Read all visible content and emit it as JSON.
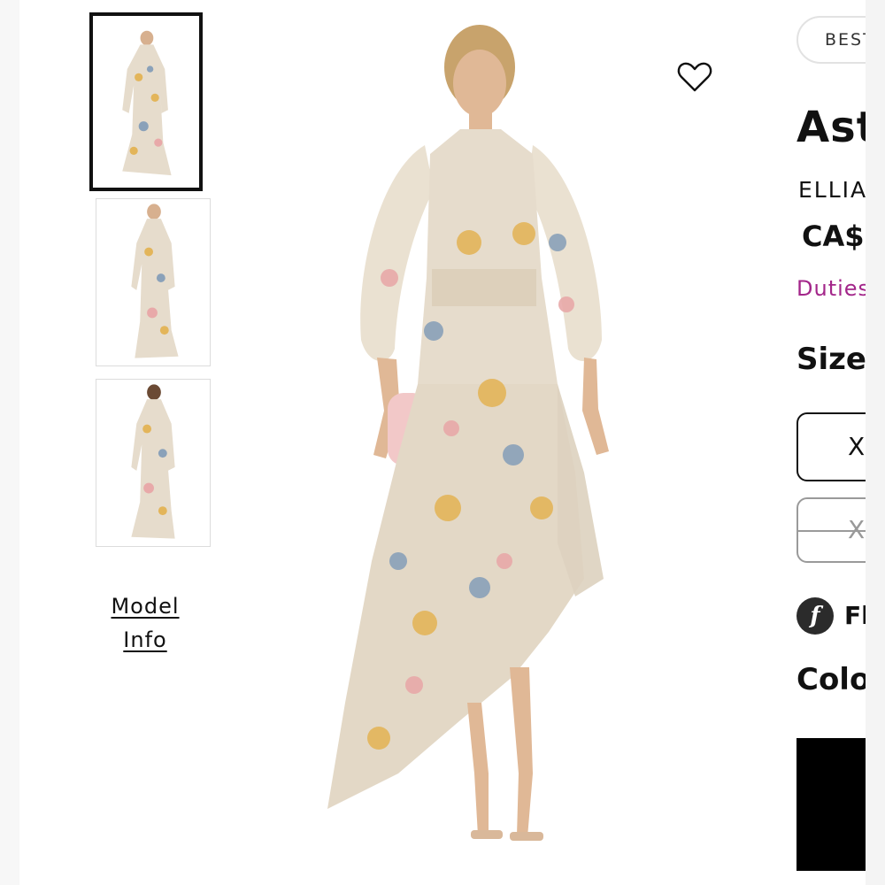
{
  "gallery": {
    "thumbnails": [
      {
        "label": "view-1",
        "active": true
      },
      {
        "label": "view-2",
        "active": false
      },
      {
        "label": "view-3",
        "active": false
      }
    ],
    "model_info_line1": "Model",
    "model_info_line2": "Info"
  },
  "product": {
    "badge": "BEST",
    "title": "Ast",
    "brand": "ELLIA",
    "price": "CA$",
    "duties": "Duties",
    "sizes_label": "Sizes",
    "size_options": [
      {
        "label": "X",
        "available": true
      },
      {
        "label": "X",
        "available": false
      }
    ],
    "flex_text": "Fl",
    "flex_icon": "f",
    "color_label": "Colo",
    "selected_color": "#000000"
  },
  "icons": {
    "wishlist": "heart-outline-icon",
    "flex": "flex-pay-icon"
  },
  "colors": {
    "accent": "#a3268a",
    "dress_base": "#e9dfcf",
    "flower_yellow": "#e3b55a",
    "flower_blue": "#8aa1b9"
  }
}
